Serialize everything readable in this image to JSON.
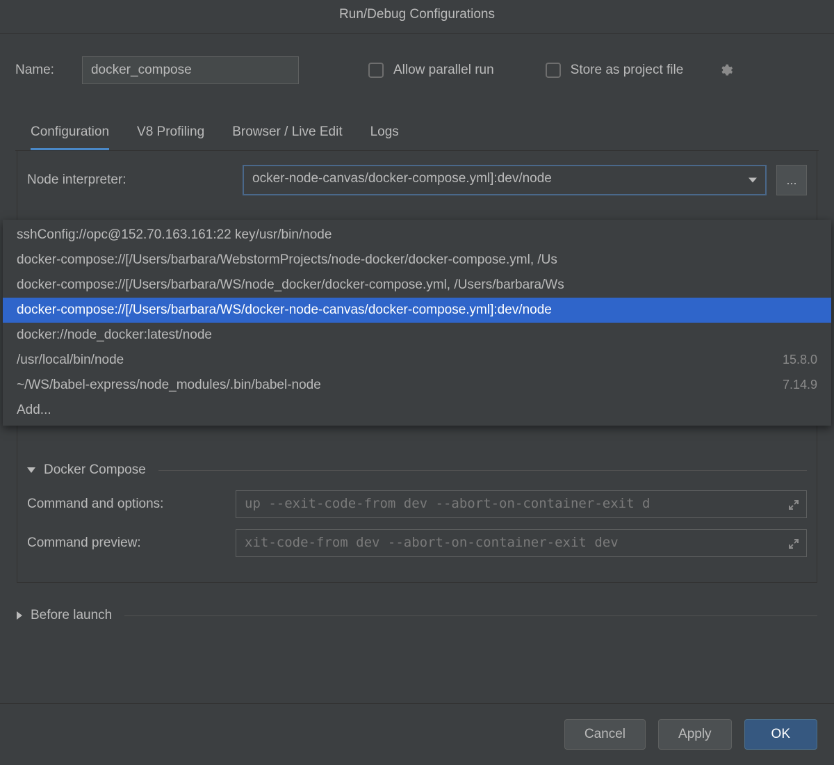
{
  "title": "Run/Debug Configurations",
  "name": {
    "label": "Name:",
    "value": "docker_compose"
  },
  "checkboxes": {
    "allow_parallel": "Allow parallel run",
    "store_project_file": "Store as project file"
  },
  "tabs": {
    "configuration": "Configuration",
    "v8_profiling": "V8 Profiling",
    "browser_live_edit": "Browser / Live Edit",
    "logs": "Logs"
  },
  "fields": {
    "node_interpreter_label": "Node interpreter:",
    "node_interpreter_value": "ocker-node-canvas/docker-compose.yml]:dev/node",
    "browse_btn": "..."
  },
  "dropdown": {
    "items": [
      {
        "label": "sshConfig://opc@152.70.163.161:22 key/usr/bin/node",
        "version": ""
      },
      {
        "label": "docker-compose://[/Users/barbara/WebstormProjects/node-docker/docker-compose.yml, /Us",
        "version": ""
      },
      {
        "label": "docker-compose://[/Users/barbara/WS/node_docker/docker-compose.yml, /Users/barbara/Ws",
        "version": ""
      },
      {
        "label": "docker-compose://[/Users/barbara/WS/docker-node-canvas/docker-compose.yml]:dev/node",
        "version": "",
        "selected": true
      },
      {
        "label": "docker://node_docker:latest/node",
        "version": ""
      },
      {
        "label": "/usr/local/bin/node",
        "version": "15.8.0"
      },
      {
        "label": "~/WS/babel-express/node_modules/.bin/babel-node",
        "version": "7.14.9"
      },
      {
        "label": "Add...",
        "version": ""
      }
    ]
  },
  "docker_compose": {
    "section_title": "Docker Compose",
    "command_options_label": "Command and options:",
    "command_options_value": "up --exit-code-from dev --abort-on-container-exit d",
    "command_preview_label": "Command preview:",
    "command_preview_value": "xit-code-from dev --abort-on-container-exit dev"
  },
  "before_launch": {
    "title": "Before launch"
  },
  "footer": {
    "cancel": "Cancel",
    "apply": "Apply",
    "ok": "OK"
  }
}
